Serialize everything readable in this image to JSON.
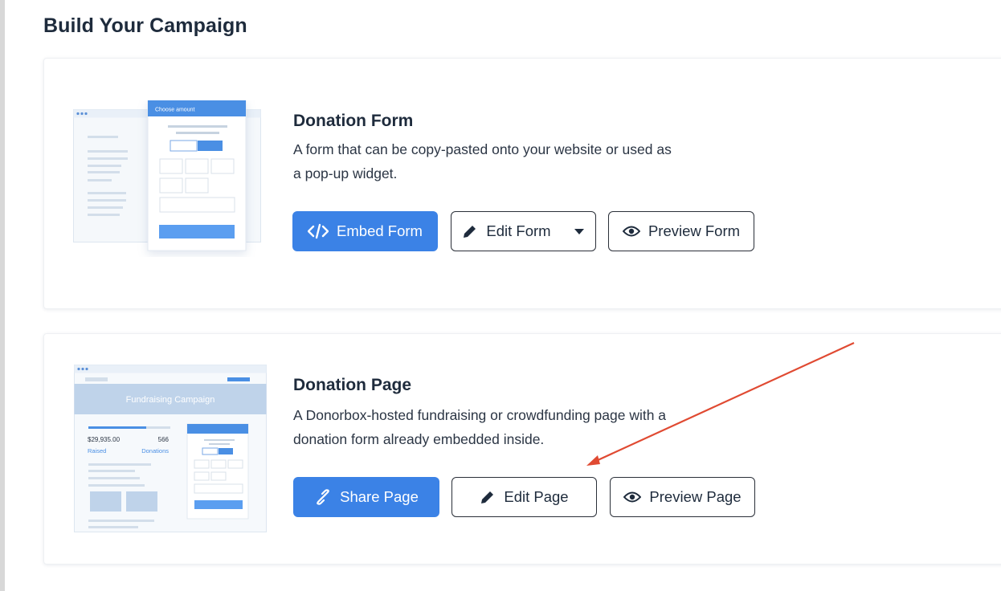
{
  "section_title": "Build Your Campaign",
  "donation_form": {
    "title": "Donation Form",
    "description": "A form that can be copy-pasted onto your website or used as a pop-up widget.",
    "thumbnail": {
      "header_label": "Choose amount"
    },
    "buttons": {
      "embed": "Embed Form",
      "edit": "Edit Form",
      "preview": "Preview Form"
    }
  },
  "donation_page": {
    "title": "Donation Page",
    "description": "A Donorbox-hosted fundraising or crowdfunding page with a donation form already embedded inside.",
    "thumbnail": {
      "banner": "Fundraising Campaign",
      "raised_amount": "$29,935.00",
      "raised_label": "Raised",
      "donations_count": "566",
      "donations_label": "Donations"
    },
    "buttons": {
      "share": "Share Page",
      "edit": "Edit Page",
      "preview": "Preview Page"
    }
  },
  "colors": {
    "primary": "#3b82e6",
    "annotation_arrow": "#e04a32",
    "heading": "#1e2b3c"
  },
  "icons": [
    "code-icon",
    "pencil-icon",
    "caret-down-icon",
    "eye-icon",
    "link-icon"
  ]
}
